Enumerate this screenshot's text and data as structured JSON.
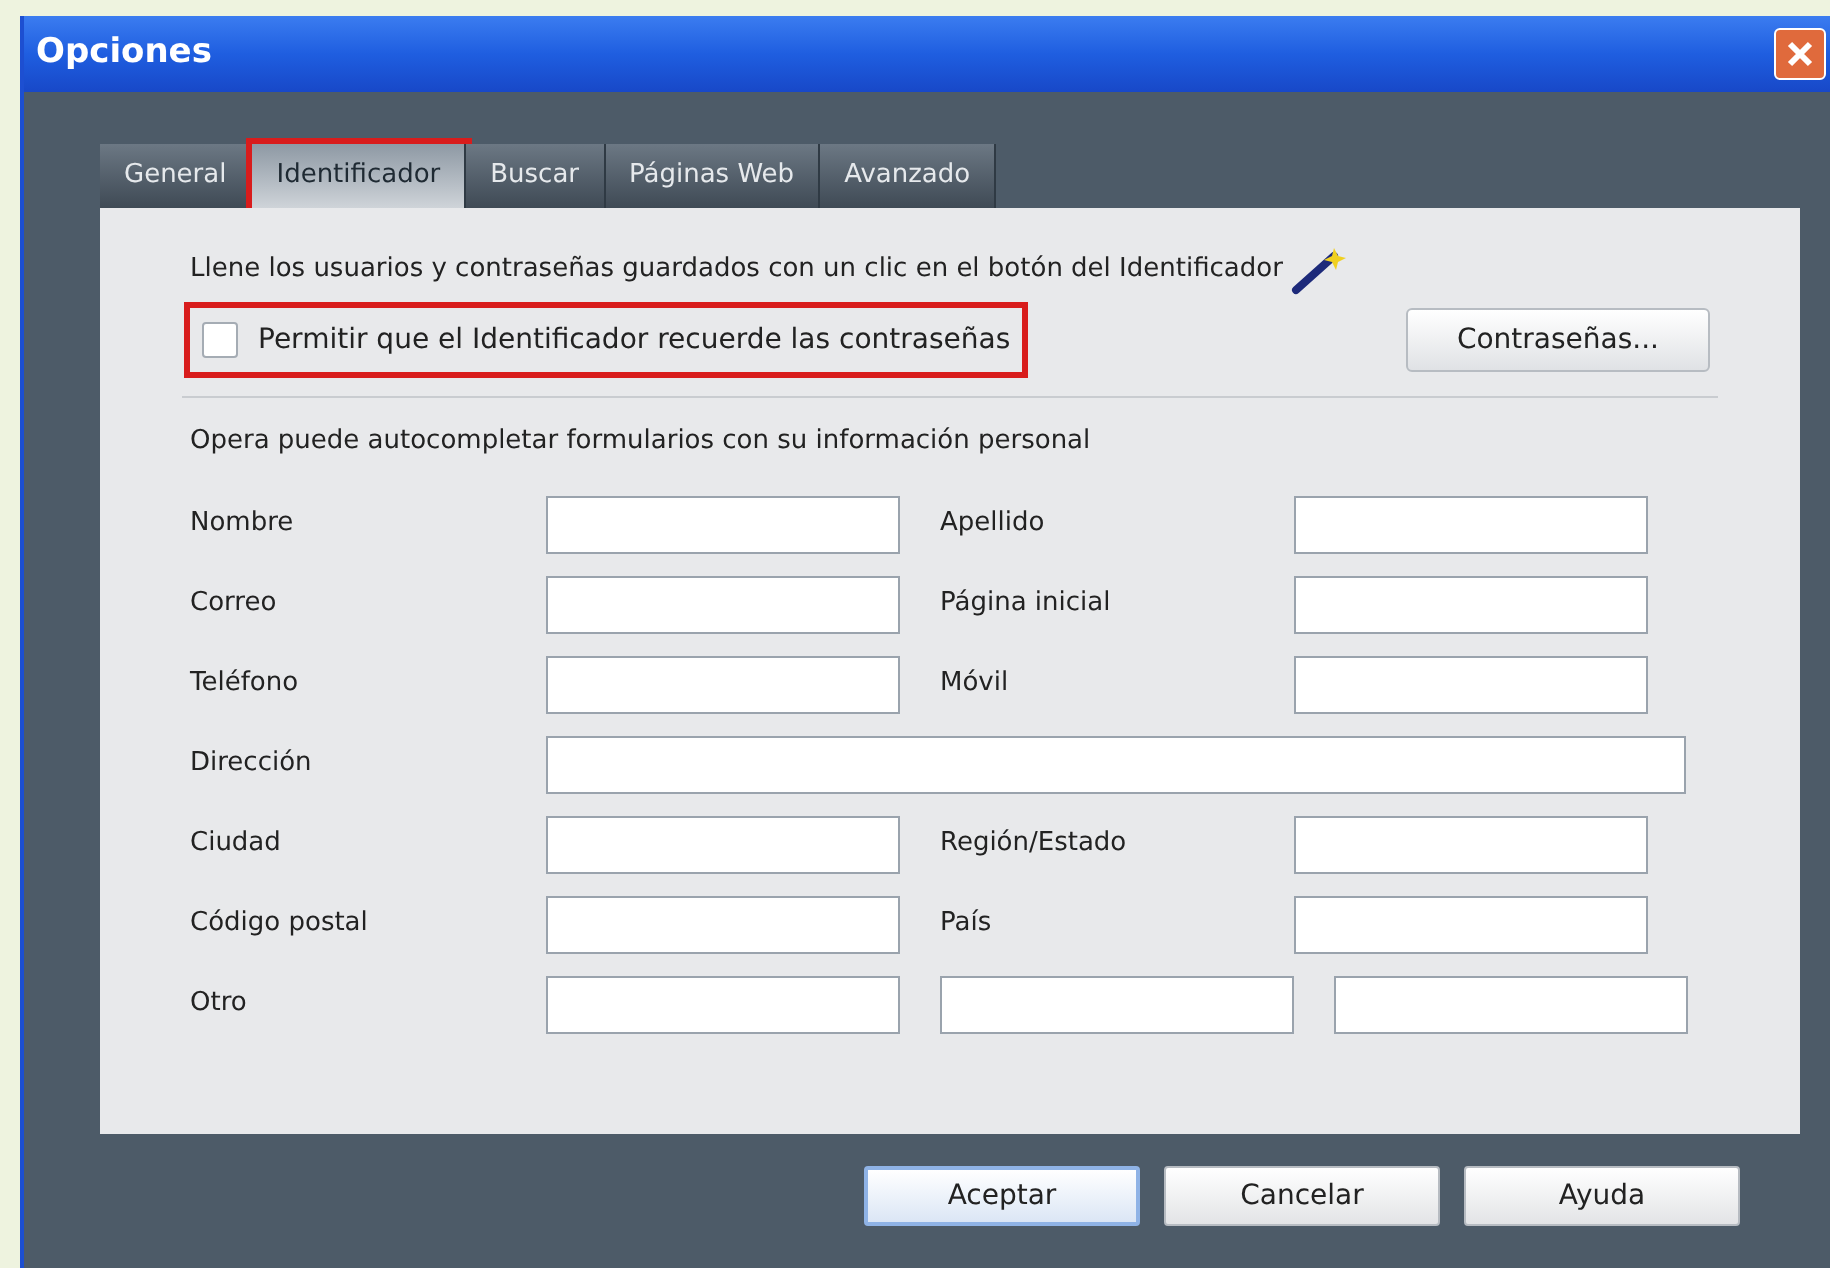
{
  "window": {
    "title": "Opciones"
  },
  "tabs": [
    {
      "label": "General",
      "selected": false,
      "highlighted": false
    },
    {
      "label": "Identificador",
      "selected": true,
      "highlighted": true
    },
    {
      "label": "Buscar",
      "selected": false,
      "highlighted": false
    },
    {
      "label": "Páginas Web",
      "selected": false,
      "highlighted": false
    },
    {
      "label": "Avanzado",
      "selected": false,
      "highlighted": false
    }
  ],
  "intro": "Llene los usuarios y contraseñas guardados con un clic en el botón del Identificador",
  "remember": {
    "label": "Permitir que el Identificador recuerde las contraseñas",
    "checked": false,
    "highlighted": true
  },
  "passwords_button": "Contraseñas...",
  "autofill_heading": "Opera puede autocompletar formularios con su información personal",
  "rows": [
    {
      "kind": "pair",
      "labels": [
        "Nombre",
        "Apellido"
      ]
    },
    {
      "kind": "pair",
      "labels": [
        "Correo",
        "Página inicial"
      ]
    },
    {
      "kind": "pair",
      "labels": [
        "Teléfono",
        "Móvil"
      ]
    },
    {
      "kind": "wide",
      "labels": [
        "Dirección"
      ]
    },
    {
      "kind": "pair",
      "labels": [
        "Ciudad",
        "Región/Estado"
      ]
    },
    {
      "kind": "pair",
      "labels": [
        "Código postal",
        "País"
      ]
    },
    {
      "kind": "triple",
      "labels": [
        "Otro"
      ]
    }
  ],
  "buttons": [
    {
      "label": "Aceptar",
      "default": true
    },
    {
      "label": "Cancelar",
      "default": false
    },
    {
      "label": "Ayuda",
      "default": false
    }
  ]
}
